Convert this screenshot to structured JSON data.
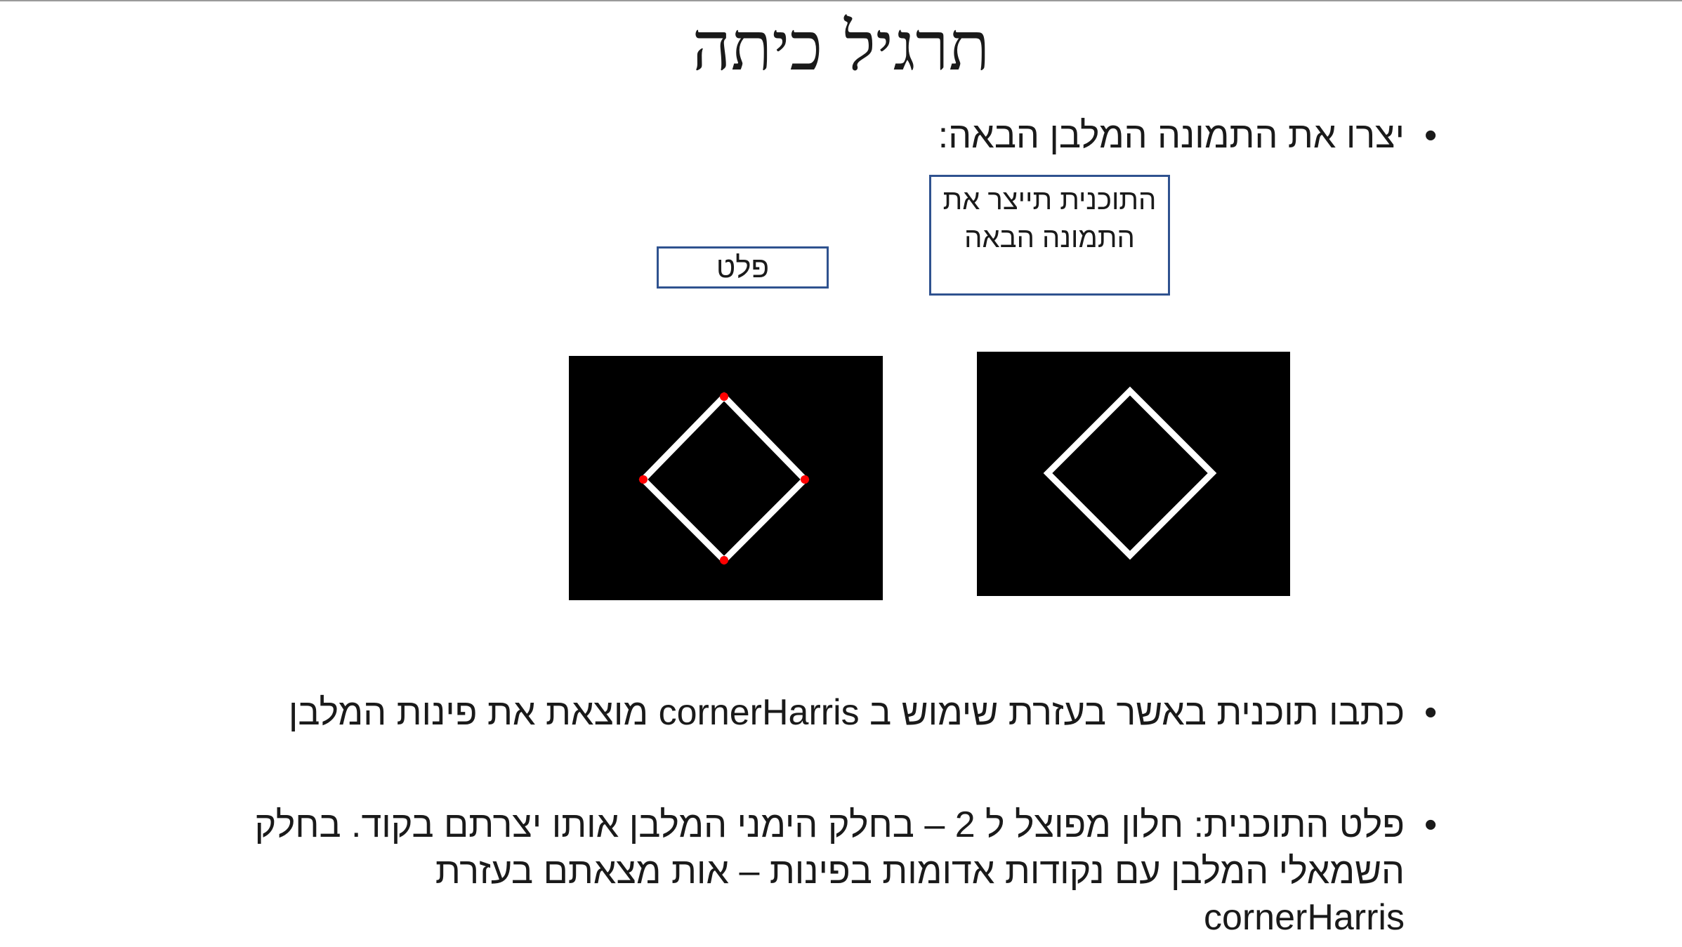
{
  "slide": {
    "title": "תרגיל כיתה",
    "bullet_glyph": "•",
    "bullets": [
      {
        "text": "יצרו את התמונה המלבן הבאה:"
      },
      {
        "text": "כתבו תוכנית באשר בעזרת שימוש ב cornerHarris מוצאת את פינות המלבן"
      },
      {
        "text": "פלט התוכנית: חלון מפוצל ל 2 – בחלק הימני המלבן אותו יצרתם בקוד. בחלק השמאלי המלבן עם נקודות אדומות בפינות – אות מצאתם בעזרת cornerHarris"
      }
    ]
  },
  "labels": {
    "plot": "פלט",
    "program": "התוכנית תייצר את התמונה הבאה"
  },
  "images": {
    "input_square": {
      "background": "#000000",
      "shape": "diamond",
      "stroke": "#ffffff"
    },
    "output_square": {
      "background": "#000000",
      "shape": "diamond",
      "stroke": "#ffffff",
      "corner_marker_color": "#ff0000",
      "corner_count": 4
    }
  },
  "colors": {
    "label_border": "#2f528f",
    "text": "#1a1a1a"
  }
}
